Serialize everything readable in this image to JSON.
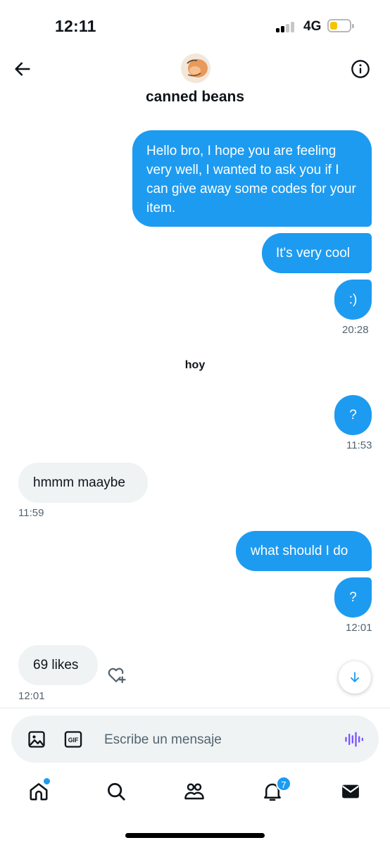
{
  "status_bar": {
    "time": "12:11",
    "network": "4G",
    "battery_color": "#f5c400"
  },
  "header": {
    "contact_name": "canned beans"
  },
  "messages": [
    {
      "direction": "outgoing",
      "text": "Hello bro, I hope you are feeling very well, I wanted to ask you if I can give away some codes for your item."
    },
    {
      "direction": "outgoing",
      "text": "It's very cool"
    },
    {
      "direction": "outgoing",
      "text": ":)",
      "time": "20:28"
    },
    {
      "direction": "outgoing",
      "text": "?",
      "time": "11:53"
    },
    {
      "direction": "incoming",
      "text": "hmmm maaybe",
      "time": "11:59"
    },
    {
      "direction": "outgoing",
      "text": "what should I do"
    },
    {
      "direction": "outgoing",
      "text": "?",
      "time": "12:01"
    },
    {
      "direction": "incoming",
      "text": "69 likes",
      "time": "12:01"
    }
  ],
  "day_separator": "hoy",
  "composer": {
    "placeholder": "Escribe un mensaje"
  },
  "nav": {
    "notifications_badge": "7"
  },
  "colors": {
    "accent": "#1d9bf0",
    "incoming_bubble": "#eff3f4",
    "voice_icon": "#7856ff"
  }
}
